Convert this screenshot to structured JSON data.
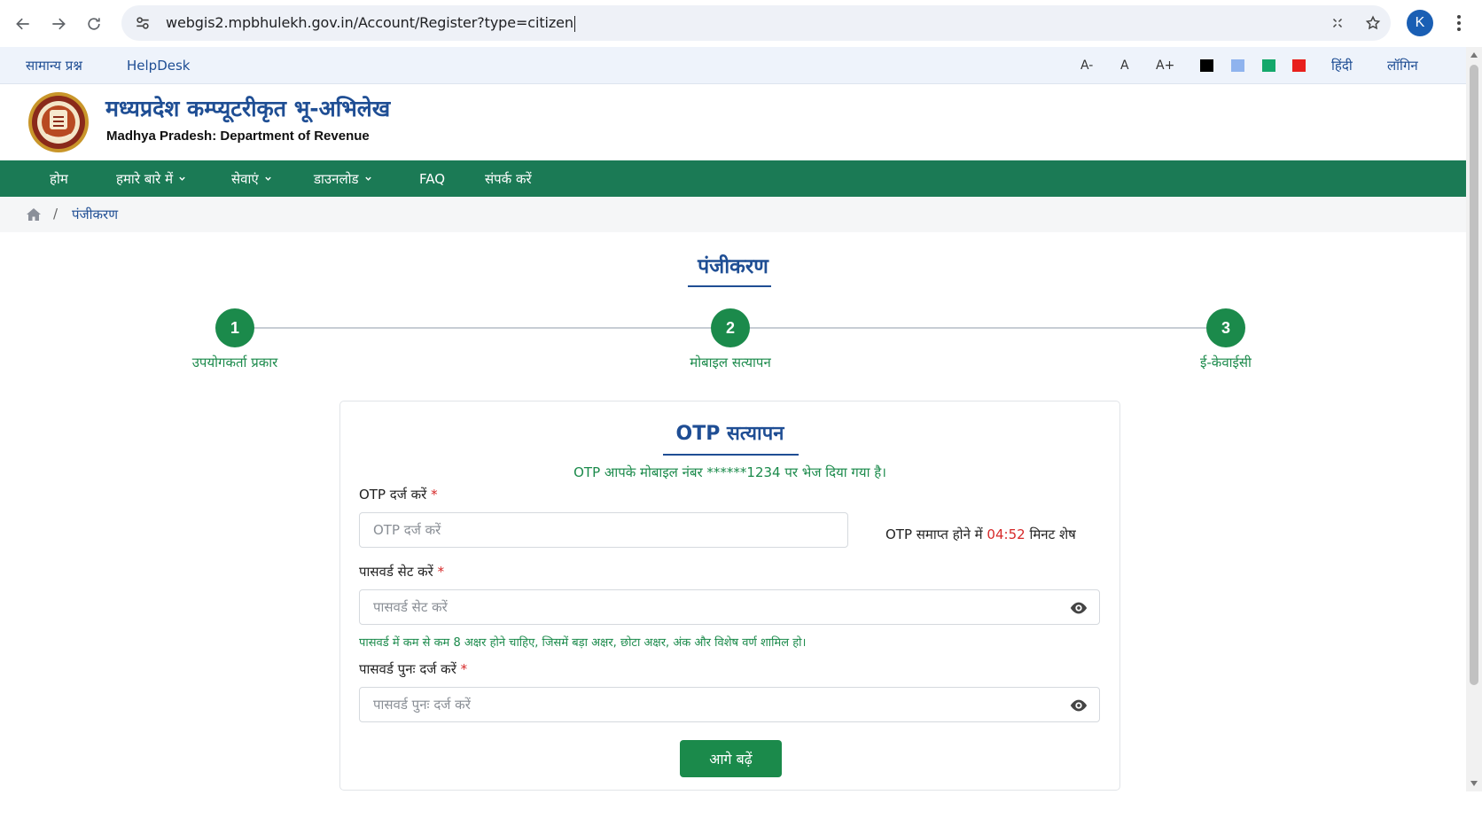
{
  "browser": {
    "url": "webgis2.mpbhulekh.gov.in/Account/Register?type=citizen",
    "avatar_letter": "K",
    "icons": [
      "back-arrow-icon",
      "forward-arrow-icon",
      "reload-icon",
      "site-info-icon",
      "install-app-icon",
      "bookmark-star-icon",
      "kebab-menu-icon"
    ]
  },
  "topbar": {
    "faq_link": "सामान्य प्रश्न",
    "helpdesk_link": "HelpDesk",
    "font_decrease": "A-",
    "font_normal": "A",
    "font_increase": "A+",
    "theme_colors": [
      "#000000",
      "#8fb3ee",
      "#14a86b",
      "#e8201c"
    ],
    "language": "हिंदी",
    "login": "लॉगिन"
  },
  "header": {
    "title": "मध्यप्रदेश कम्प्यूटरीकृत भू-अभिलेख",
    "subtitle": "Madhya Pradesh: Department of Revenue"
  },
  "nav": {
    "home": "होम",
    "about": "हमारे बारे में",
    "services": "सेवाएं",
    "downloads": "डाउनलोड",
    "faq": "FAQ",
    "contact": "संपर्क करें"
  },
  "breadcrumb": {
    "current": "पंजीकरण"
  },
  "page": {
    "title": "पंजीकरण"
  },
  "stepper": {
    "steps": [
      {
        "number": "1",
        "label": "उपयोगकर्ता प्रकार"
      },
      {
        "number": "2",
        "label": "मोबाइल सत्यापन"
      },
      {
        "number": "3",
        "label": "ई-केवाईसी"
      }
    ]
  },
  "form": {
    "title": "OTP सत्यापन",
    "otp_message": "OTP आपके मोबाइल नंबर ******1234 पर भेज दिया गया है।",
    "otp_label": "OTP दर्ज करें",
    "otp_placeholder": "OTP दर्ज करें",
    "timer_prefix": "OTP समाप्त होने में",
    "timer_value": "04:52",
    "timer_suffix": "मिनट शेष",
    "password_label": "पासवर्ड सेट करें",
    "password_placeholder": "पासवर्ड सेट करें",
    "password_hint": "पासवर्ड में कम से कम 8 अक्षर होने चाहिए, जिसमें बड़ा अक्षर, छोटा अक्षर, अंक और विशेष वर्ण शामिल हो।",
    "confirm_label": "पासवर्ड पुनः दर्ज करें",
    "confirm_placeholder": "पासवर्ड पुनः दर्ज करें",
    "required_mark": "*",
    "submit": "आगे बढ़ें"
  },
  "colors": {
    "brand_blue": "#1f4e94",
    "nav_green": "#1b7a55",
    "step_green": "#1b8a4b",
    "error_red": "#d62828"
  }
}
